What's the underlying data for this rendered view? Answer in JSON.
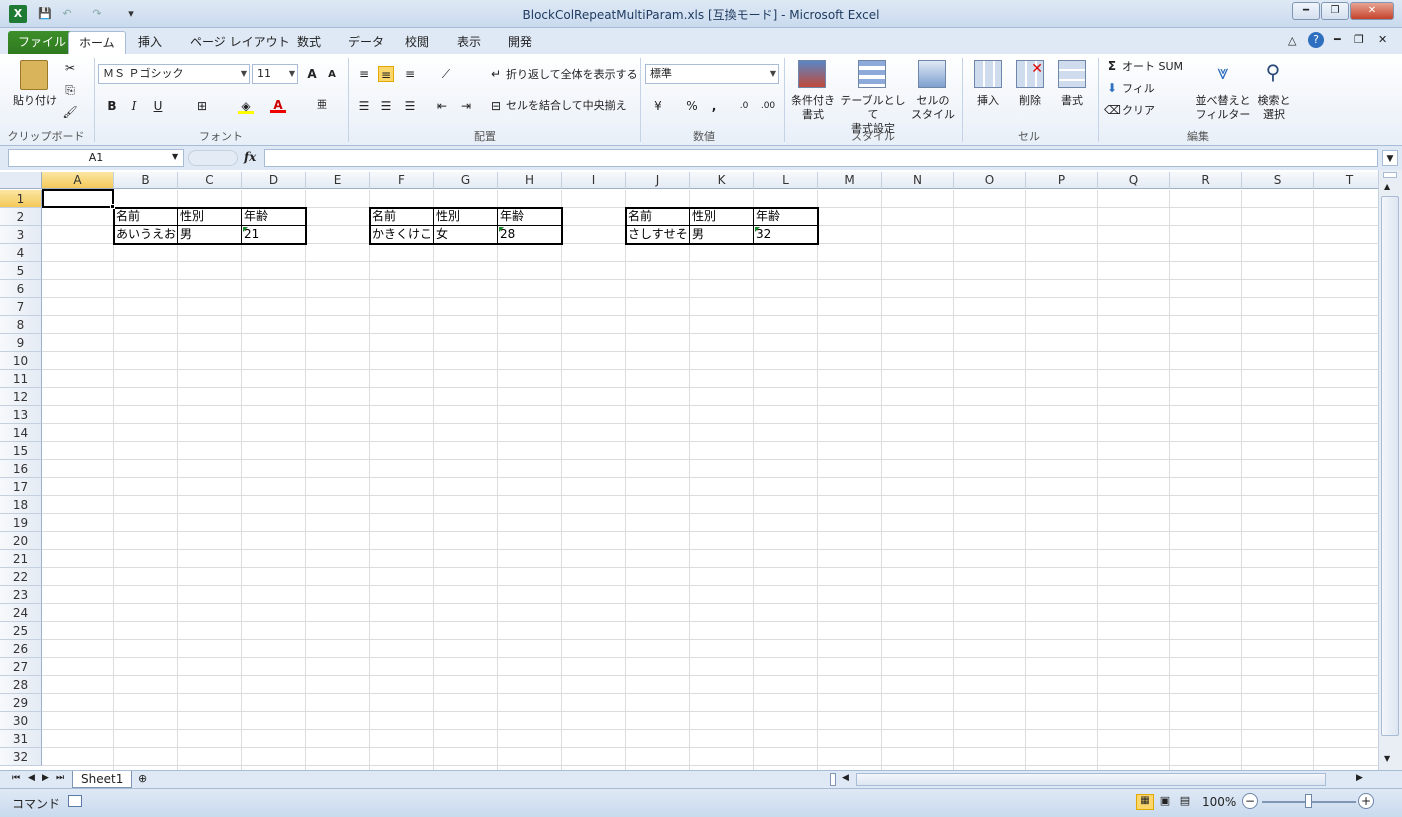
{
  "window": {
    "title": "BlockColRepeatMultiParam.xls  [互換モード] - Microsoft Excel"
  },
  "ribbon_tabs": [
    "ファイル",
    "ホーム",
    "挿入",
    "ページ レイアウト",
    "数式",
    "データ",
    "校閲",
    "表示",
    "開発"
  ],
  "ribbon": {
    "clipboard": {
      "paste": "貼り付け",
      "label": "クリップボード"
    },
    "font": {
      "name": "ＭＳ Ｐゴシック",
      "size": "11",
      "label": "フォント"
    },
    "alignment": {
      "wrap": "折り返して全体を表示する",
      "merge": "セルを結合して中央揃え",
      "label": "配置"
    },
    "number": {
      "format": "標準",
      "label": "数値"
    },
    "styles": {
      "conditional": "条件付き\n書式",
      "table": "テーブルとして\n書式設定",
      "cell": "セルの\nスタイル",
      "label": "スタイル"
    },
    "cells": {
      "insert": "挿入",
      "delete": "削除",
      "format": "書式",
      "label": "セル"
    },
    "editing": {
      "autosum": "オート SUM",
      "fill": "フィル",
      "clear": "クリア",
      "sort": "並べ替えと\nフィルター",
      "find": "検索と\n選択",
      "label": "編集"
    }
  },
  "formula_bar": {
    "name_box": "A1",
    "fx": "fx",
    "formula": ""
  },
  "columns": [
    "A",
    "B",
    "C",
    "D",
    "E",
    "F",
    "G",
    "H",
    "I",
    "J",
    "K",
    "L",
    "M",
    "N",
    "O",
    "P",
    "Q",
    "R",
    "S",
    "T"
  ],
  "rows": [
    "1",
    "2",
    "3",
    "4",
    "5",
    "6",
    "7",
    "8",
    "9",
    "10",
    "11",
    "12",
    "13",
    "14",
    "15",
    "16",
    "17",
    "18",
    "19",
    "20",
    "21",
    "22",
    "23",
    "24",
    "25",
    "26",
    "27",
    "28",
    "29",
    "30",
    "31",
    "32"
  ],
  "blocks": [
    {
      "headers": [
        "名前",
        "性別",
        "年齢"
      ],
      "values": [
        "あいうえお",
        "男",
        "21"
      ]
    },
    {
      "headers": [
        "名前",
        "性別",
        "年齢"
      ],
      "values": [
        "かきくけこ",
        "女",
        "28"
      ]
    },
    {
      "headers": [
        "名前",
        "性別",
        "年齢"
      ],
      "values": [
        "さしすせそ",
        "男",
        "32"
      ]
    }
  ],
  "sheets": [
    "Sheet1"
  ],
  "status": {
    "mode": "コマンド",
    "zoom": "100%"
  }
}
